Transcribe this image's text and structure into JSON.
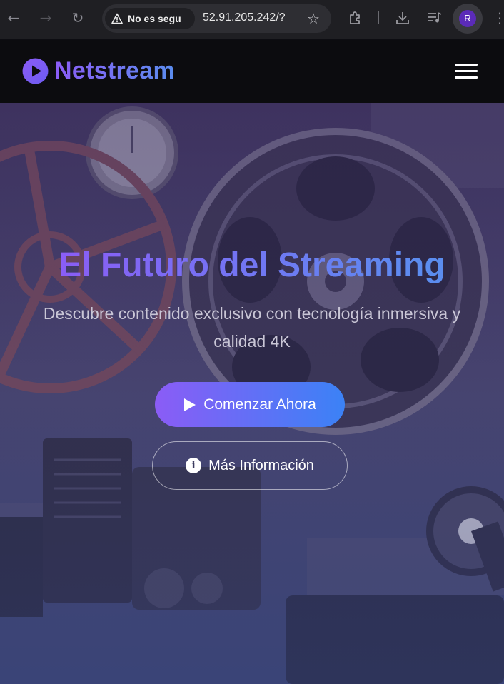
{
  "browser": {
    "security_label": "No es segu",
    "url": "52.91.205.242/?",
    "profile_initial": "R",
    "icons": [
      "back-arrow-icon",
      "forward-arrow-icon",
      "reload-icon",
      "warning-icon",
      "star-icon",
      "extensions-icon",
      "download-icon",
      "media-icon",
      "more-icon"
    ]
  },
  "site": {
    "brand": "Netstream",
    "menu_icon": "hamburger-menu-icon"
  },
  "hero": {
    "title": "El Futuro del Streaming",
    "subtitle": "Descubre contenido exclusivo con tecnología inmersiva y calidad 4K",
    "primary_button": "Comenzar Ahora",
    "secondary_button": "Más Información"
  },
  "colors": {
    "accent_purple": "#8b5cf6",
    "accent_blue": "#3b82f6",
    "header_bg": "#0c0c0f"
  }
}
